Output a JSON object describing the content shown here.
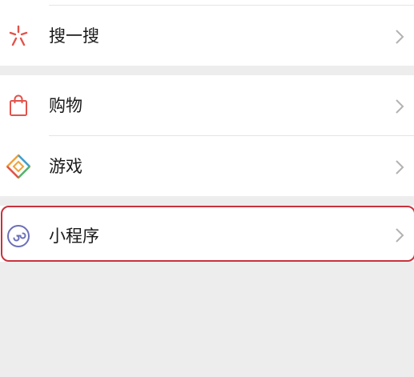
{
  "menu": {
    "items": [
      {
        "id": "search",
        "label": "搜一搜",
        "icon": "sparkle-icon",
        "icon_color": "#e2534b"
      },
      {
        "id": "shopping",
        "label": "购物",
        "icon": "shopping-bag-icon",
        "icon_color": "#e2534b"
      },
      {
        "id": "games",
        "label": "游戏",
        "icon": "game-diamond-icon",
        "icon_color": "#f0a23b"
      },
      {
        "id": "miniprogram",
        "label": "小程序",
        "icon": "mini-program-icon",
        "icon_color": "#6b6fb8"
      }
    ]
  },
  "colors": {
    "background": "#ededed",
    "card": "#ffffff",
    "divider": "#e5e5e5",
    "chevron": "#b2b2b2",
    "highlight_border": "#c8323d"
  }
}
